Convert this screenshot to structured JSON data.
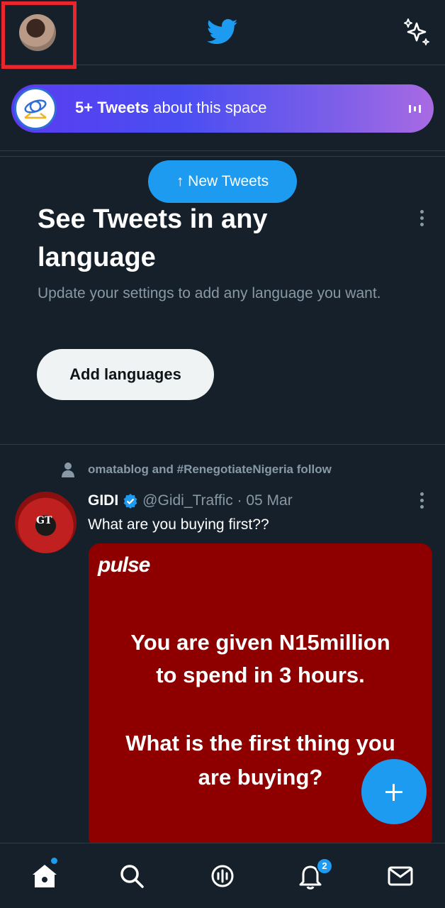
{
  "header": {
    "avatar_icon": "user-profile-photo",
    "logo_icon": "twitter-bird-icon",
    "timeline_icon": "sparkle-icon"
  },
  "space_banner": {
    "count_label": "5+ Tweets",
    "suffix": " about this space",
    "icon": "space-logo-icon"
  },
  "new_tweets": {
    "label": "↑ New Tweets"
  },
  "language_prompt": {
    "title": "See Tweets in any language",
    "subtitle": "Update your settings to add any language you want.",
    "button_label": "Add languages"
  },
  "tweet": {
    "social_context": "omatablog and #RenegotiateNigeria follow",
    "author_name": "GIDI",
    "handle_date": "@Gidi_Traffic · 05 Mar",
    "text": "What are you buying first??",
    "avatar_initials": "GT",
    "image": {
      "brand": "pulse",
      "line1": "You are given N15million",
      "line2": "to spend in 3 hours.",
      "line3": "What is the first thing you",
      "line4": "are buying?"
    }
  },
  "bottom_nav": {
    "items": [
      "home-icon",
      "search-icon",
      "spaces-icon",
      "notifications-icon",
      "messages-icon"
    ],
    "notification_count": "2"
  },
  "colors": {
    "background": "#15202b",
    "accent": "#1d9bf0",
    "muted_text": "#8899a6",
    "tweet_image_bg": "#8e0000"
  }
}
